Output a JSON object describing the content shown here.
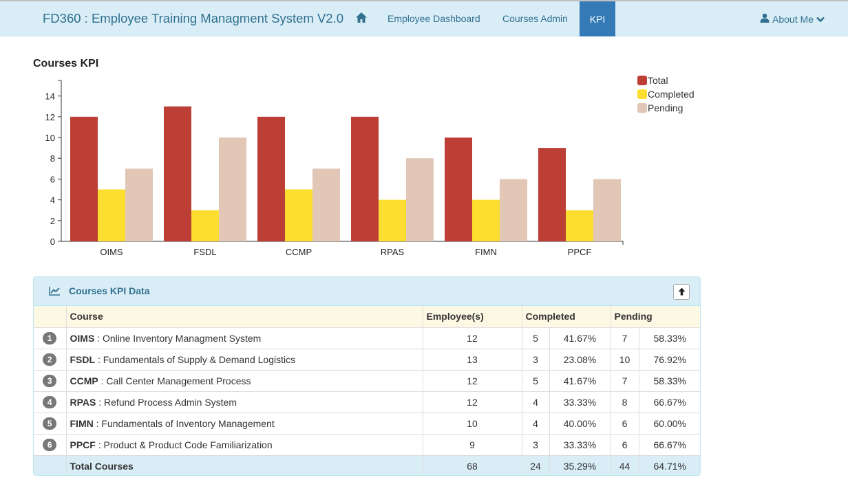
{
  "navbar": {
    "brand": "FD360 : Employee Training Managment System V2.0",
    "links": [
      "Employee Dashboard",
      "Courses Admin"
    ],
    "active": "KPI",
    "about": "About Me"
  },
  "chart_title": "Courses KPI",
  "legend": [
    {
      "label": "Total",
      "color": "#bc3e35"
    },
    {
      "label": "Completed",
      "color": "#fbde2f"
    },
    {
      "label": "Pending",
      "color": "#e2c6b6"
    }
  ],
  "chart_data": {
    "type": "bar",
    "title": "Courses KPI",
    "categories": [
      "OIMS",
      "FSDL",
      "CCMP",
      "RPAS",
      "FIMN",
      "PPCF"
    ],
    "series": [
      {
        "name": "Total",
        "values": [
          12,
          13,
          12,
          12,
          10,
          9
        ],
        "color": "#bc3e35"
      },
      {
        "name": "Completed",
        "values": [
          5,
          3,
          5,
          4,
          4,
          3
        ],
        "color": "#fbde2f"
      },
      {
        "name": "Pending",
        "values": [
          7,
          10,
          7,
          8,
          6,
          6
        ],
        "color": "#e2c6b6"
      }
    ],
    "yticks": [
      0,
      2,
      4,
      6,
      8,
      10,
      12,
      14
    ],
    "ylim": [
      0,
      15.5
    ],
    "grid": false,
    "legend_position": "top-right"
  },
  "panel": {
    "title": "Courses KPI Data"
  },
  "table": {
    "headers": [
      "Course",
      "Employee(s)",
      "Completed",
      "Pending"
    ],
    "rows": [
      {
        "idx": "1",
        "code": "OIMS",
        "name": " : Online Inventory Managment System",
        "employees": "12",
        "completed": "5",
        "completed_pct": "41.67%",
        "pending": "7",
        "pending_pct": "58.33%"
      },
      {
        "idx": "2",
        "code": "FSDL",
        "name": " : Fundamentals of Supply & Demand Logistics",
        "employees": "13",
        "completed": "3",
        "completed_pct": "23.08%",
        "pending": "10",
        "pending_pct": "76.92%"
      },
      {
        "idx": "3",
        "code": "CCMP",
        "name": " : Call Center Management Process",
        "employees": "12",
        "completed": "5",
        "completed_pct": "41.67%",
        "pending": "7",
        "pending_pct": "58.33%"
      },
      {
        "idx": "4",
        "code": "RPAS",
        "name": " : Refund Process Admin System",
        "employees": "12",
        "completed": "4",
        "completed_pct": "33.33%",
        "pending": "8",
        "pending_pct": "66.67%"
      },
      {
        "idx": "5",
        "code": "FIMN",
        "name": " : Fundamentals of Inventory Management",
        "employees": "10",
        "completed": "4",
        "completed_pct": "40.00%",
        "pending": "6",
        "pending_pct": "60.00%"
      },
      {
        "idx": "6",
        "code": "PPCF",
        "name": " : Product & Product Code Familiarization",
        "employees": "9",
        "completed": "3",
        "completed_pct": "33.33%",
        "pending": "6",
        "pending_pct": "66.67%"
      }
    ],
    "footer": {
      "label": "Total Courses",
      "employees": "68",
      "completed": "24",
      "completed_pct": "35.29%",
      "pending": "44",
      "pending_pct": "64.71%"
    }
  }
}
